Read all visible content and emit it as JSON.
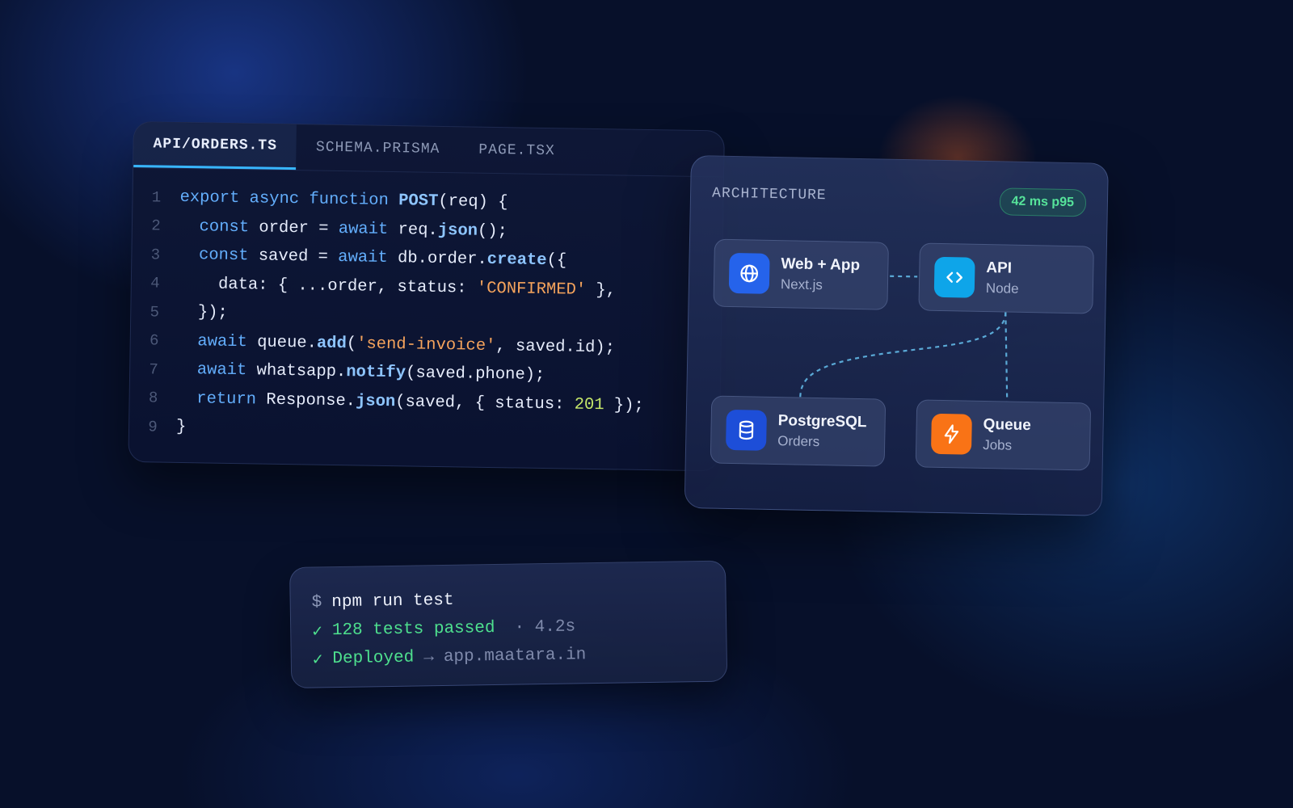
{
  "editor": {
    "tabs": [
      {
        "label": "API/ORDERS.TS",
        "active": true
      },
      {
        "label": "SCHEMA.PRISMA",
        "active": false
      },
      {
        "label": "PAGE.TSX",
        "active": false
      }
    ],
    "lines": [
      {
        "n": "1",
        "tokens": [
          [
            "kw",
            "export async function "
          ],
          [
            "fn",
            "POST"
          ],
          [
            "src",
            "(req) {"
          ]
        ]
      },
      {
        "n": "2",
        "tokens": [
          [
            "src",
            "  "
          ],
          [
            "kw",
            "const "
          ],
          [
            "src",
            "order = "
          ],
          [
            "kw",
            "await "
          ],
          [
            "src",
            "req."
          ],
          [
            "fn",
            "json"
          ],
          [
            "src",
            "();"
          ]
        ]
      },
      {
        "n": "3",
        "tokens": [
          [
            "src",
            "  "
          ],
          [
            "kw",
            "const "
          ],
          [
            "src",
            "saved = "
          ],
          [
            "kw",
            "await "
          ],
          [
            "src",
            "db.order."
          ],
          [
            "fn",
            "create"
          ],
          [
            "src",
            "({"
          ]
        ]
      },
      {
        "n": "4",
        "tokens": [
          [
            "src",
            "    data: { ...order, status: "
          ],
          [
            "str",
            "'CONFIRMED'"
          ],
          [
            "src",
            " },"
          ]
        ]
      },
      {
        "n": "5",
        "tokens": [
          [
            "src",
            "  });"
          ]
        ]
      },
      {
        "n": "6",
        "tokens": [
          [
            "src",
            "  "
          ],
          [
            "kw",
            "await "
          ],
          [
            "src",
            "queue."
          ],
          [
            "fn",
            "add"
          ],
          [
            "src",
            "("
          ],
          [
            "str",
            "'send-invoice'"
          ],
          [
            "src",
            ", saved.id);"
          ]
        ]
      },
      {
        "n": "7",
        "tokens": [
          [
            "src",
            "  "
          ],
          [
            "kw",
            "await "
          ],
          [
            "src",
            "whatsapp."
          ],
          [
            "fn",
            "notify"
          ],
          [
            "src",
            "(saved.phone);"
          ]
        ]
      },
      {
        "n": "8",
        "tokens": [
          [
            "src",
            "  "
          ],
          [
            "kw",
            "return "
          ],
          [
            "src",
            "Response."
          ],
          [
            "fn",
            "json"
          ],
          [
            "src",
            "(saved, { status: "
          ],
          [
            "num",
            "201"
          ],
          [
            "src",
            " });"
          ]
        ]
      },
      {
        "n": "9",
        "tokens": [
          [
            "src",
            "}"
          ]
        ]
      }
    ]
  },
  "architecture": {
    "title": "ARCHITECTURE",
    "latency_badge": "42 ms p95",
    "nodes": {
      "web": {
        "title": "Web + App",
        "subtitle": "Next.js",
        "icon": "globe-icon",
        "color": "#2563eb"
      },
      "api": {
        "title": "API",
        "subtitle": "Node",
        "icon": "code-icon",
        "color": "#0ea5e9"
      },
      "db": {
        "title": "PostgreSQL",
        "subtitle": "Orders",
        "icon": "database-icon",
        "color": "#1d4ed8"
      },
      "queue": {
        "title": "Queue",
        "subtitle": "Jobs",
        "icon": "lightning-icon",
        "color": "#f97316"
      }
    }
  },
  "terminal": {
    "prompt": "$",
    "command": "npm run test",
    "check": "✓",
    "tests_text": "128 tests passed",
    "tests_time": "· 4.2s",
    "deployed_text": "Deployed",
    "arrow": "→",
    "url": "app.maatara.in"
  }
}
